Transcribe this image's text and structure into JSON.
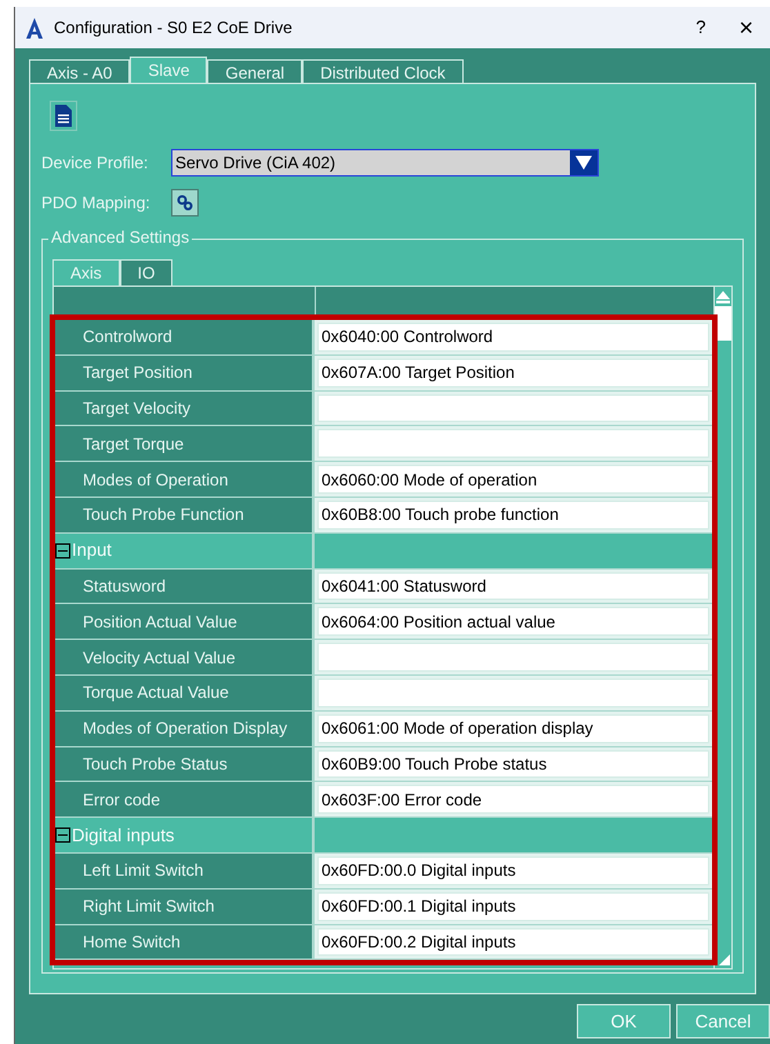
{
  "window": {
    "title": "Configuration - S0 E2 CoE Drive",
    "help": "?",
    "close": "×"
  },
  "tabs": [
    {
      "label": "Axis - A0",
      "selected": false
    },
    {
      "label": "Slave",
      "selected": true
    },
    {
      "label": "General",
      "selected": false
    },
    {
      "label": "Distributed Clock",
      "selected": false
    }
  ],
  "device_profile": {
    "label": "Device Profile:",
    "value": "Servo Drive (CiA 402)"
  },
  "pdo_mapping": {
    "label": "PDO Mapping:"
  },
  "advanced_settings": {
    "title": "Advanced Settings",
    "tabs": [
      {
        "label": "Axis",
        "selected": true
      },
      {
        "label": "IO",
        "selected": false
      }
    ],
    "sections": [
      {
        "items": [
          {
            "name": "Controlword",
            "value": "0x6040:00 Controlword"
          },
          {
            "name": "Target Position",
            "value": "0x607A:00 Target Position"
          },
          {
            "name": "Target Velocity"
          },
          {
            "name": "Target Torque"
          },
          {
            "name": "Modes of Operation",
            "value": "0x6060:00 Mode of operation"
          },
          {
            "name": "Touch Probe Function",
            "value": "0x60B8:00 Touch probe function"
          }
        ]
      },
      {
        "title": "Input",
        "expanded": true,
        "items": [
          {
            "name": "Statusword",
            "value": "0x6041:00 Statusword"
          },
          {
            "name": "Position Actual Value",
            "value": "0x6064:00 Position actual value"
          },
          {
            "name": "Velocity Actual Value"
          },
          {
            "name": "Torque Actual Value"
          },
          {
            "name": "Modes of Operation Display",
            "value": "0x6061:00 Mode of operation display"
          },
          {
            "name": "Touch Probe Status",
            "value": "0x60B9:00 Touch Probe status"
          },
          {
            "name": "Error code",
            "value": "0x603F:00 Error code"
          }
        ]
      },
      {
        "title": "Digital inputs",
        "expanded": true,
        "items": [
          {
            "name": "Left Limit Switch",
            "value": "0x60FD:00.0 Digital inputs"
          },
          {
            "name": "Right Limit Switch",
            "value": "0x60FD:00.1 Digital inputs"
          },
          {
            "name": "Home Switch",
            "value": "0x60FD:00.2 Digital inputs"
          }
        ]
      }
    ]
  },
  "buttons": [
    "OK",
    "Cancel"
  ]
}
